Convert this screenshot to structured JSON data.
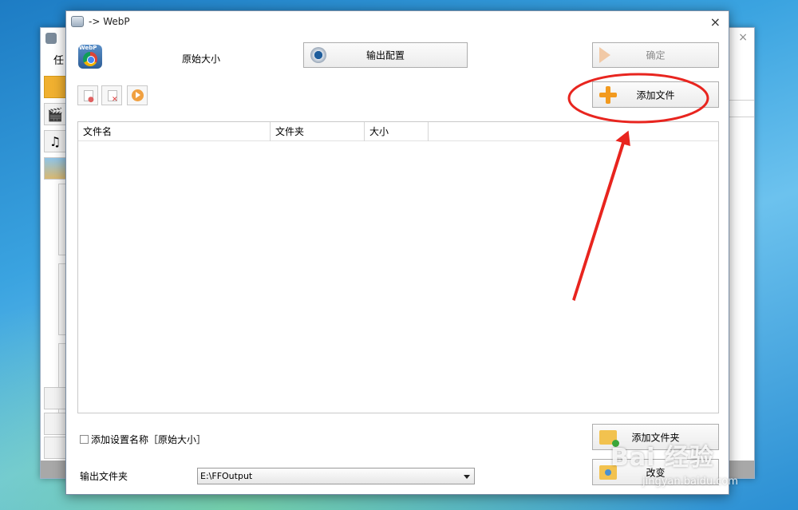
{
  "background_window": {
    "menu_partial": "任"
  },
  "dialog": {
    "title": "-> WebP",
    "close_glyph": "×",
    "format_badge": "WebP",
    "size_label": "原始大小",
    "output_config_label": "输出配置",
    "confirm_label": "确定",
    "add_file_label": "添加文件",
    "table_headers": [
      "文件名",
      "文件夹",
      "大小"
    ],
    "checkbox_label": "添加设置名称［原始大小］",
    "add_folder_label": "添加文件夹",
    "change_label": "改变",
    "output_folder_label": "输出文件夹",
    "output_folder_value": "E:\\FFOutput"
  },
  "watermark": {
    "logo": "Bai 经验",
    "url": "jingyan.baidu.com"
  },
  "annotation": {
    "color": "#e8251f"
  }
}
